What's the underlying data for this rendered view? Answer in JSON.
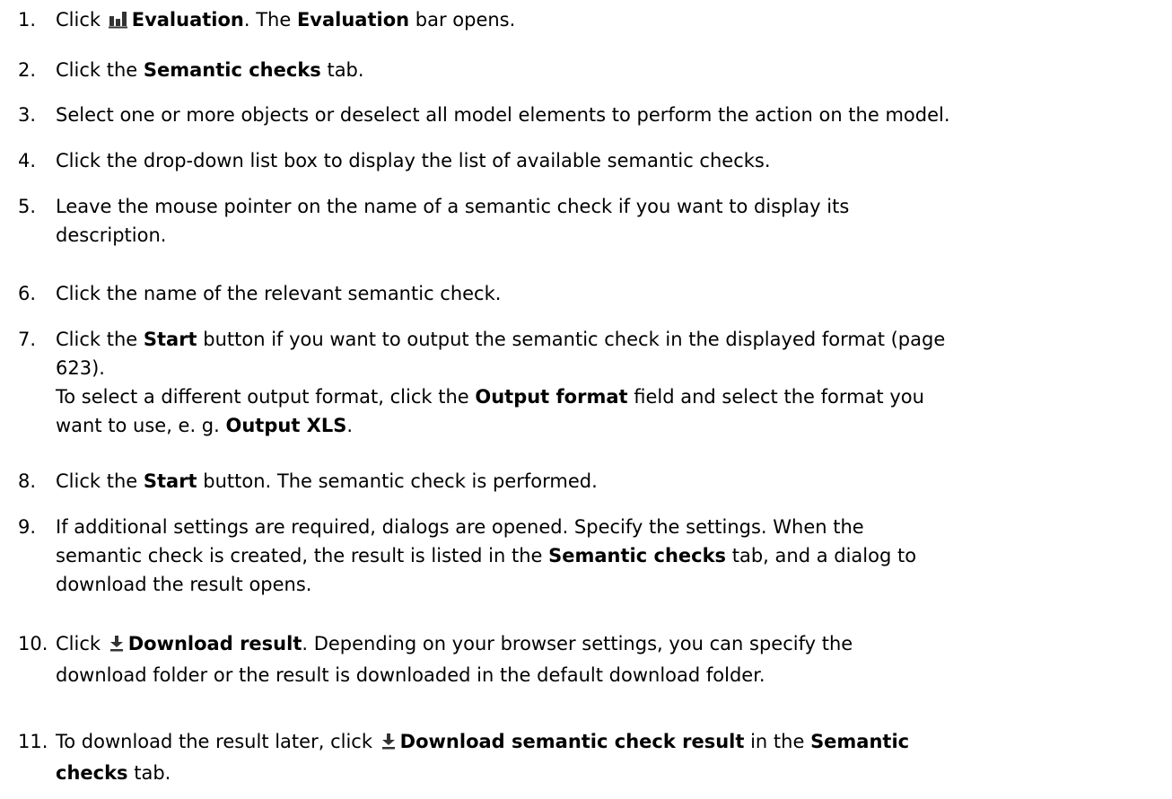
{
  "steps": [
    {
      "num": "1.",
      "lines": [
        [
          {
            "t": "Click "
          },
          {
            "icon": "evaluation-icon"
          },
          {
            "t": "Evaluation",
            "b": true
          },
          {
            "t": ". The "
          },
          {
            "t": "Evaluation",
            "b": true
          },
          {
            "t": " bar opens."
          }
        ]
      ]
    },
    {
      "num": "2.",
      "lines": [
        [
          {
            "t": "Click the "
          },
          {
            "t": "Semantic checks",
            "b": true
          },
          {
            "t": " tab."
          }
        ]
      ]
    },
    {
      "num": "3.",
      "lines": [
        [
          {
            "t": "Select one or more objects or deselect all model elements to perform the action on the model."
          }
        ]
      ]
    },
    {
      "num": "4.",
      "lines": [
        [
          {
            "t": "Click the drop-down list box to display the list of available semantic checks."
          }
        ]
      ]
    },
    {
      "num": "5.",
      "lines": [
        [
          {
            "t": "Leave the mouse pointer on the name of a semantic check if you want to display its"
          }
        ],
        [
          {
            "t": "description."
          }
        ]
      ]
    },
    {
      "num": "6.",
      "lines": [
        [
          {
            "t": "Click the name of the relevant semantic check."
          }
        ]
      ]
    },
    {
      "num": "7.",
      "lines": [
        [
          {
            "t": "Click the "
          },
          {
            "t": "Start",
            "b": true
          },
          {
            "t": " button if you want to output the semantic check in the displayed format (page"
          }
        ],
        [
          {
            "t": "623)."
          }
        ],
        [
          {
            "t": "To select a different output format, click the "
          },
          {
            "t": "Output format",
            "b": true
          },
          {
            "t": " field and select the format you"
          }
        ],
        [
          {
            "t": "want to use, e. g. "
          },
          {
            "t": "Output XLS",
            "b": true
          },
          {
            "t": "."
          }
        ]
      ]
    },
    {
      "num": "8.",
      "lines": [
        [
          {
            "t": "Click the "
          },
          {
            "t": "Start",
            "b": true
          },
          {
            "t": " button. The semantic check is performed."
          }
        ]
      ]
    },
    {
      "num": "9.",
      "lines": [
        [
          {
            "t": "If additional settings are required, dialogs are opened. Specify the settings. When the"
          }
        ],
        [
          {
            "t": "semantic check is created, the result is listed in the "
          },
          {
            "t": "Semantic checks",
            "b": true
          },
          {
            "t": " tab, and a dialog to"
          }
        ],
        [
          {
            "t": "download the result opens."
          }
        ]
      ]
    },
    {
      "num": "10.",
      "lines": [
        [
          {
            "t": "Click "
          },
          {
            "icon": "download-icon"
          },
          {
            "t": "Download result",
            "b": true
          },
          {
            "t": ". Depending on your browser settings, you can specify the"
          }
        ],
        [
          {
            "t": "download folder or the result is downloaded in the default download folder."
          }
        ]
      ]
    },
    {
      "num": "11.",
      "lines": [
        [
          {
            "t": "To download the result later, click "
          },
          {
            "icon": "download-icon"
          },
          {
            "t": "Download semantic check result",
            "b": true
          },
          {
            "t": " in the "
          },
          {
            "t": "Semantic",
            "b": true
          }
        ],
        [
          {
            "t": "checks",
            "b": true
          },
          {
            "t": " tab."
          }
        ]
      ]
    }
  ]
}
